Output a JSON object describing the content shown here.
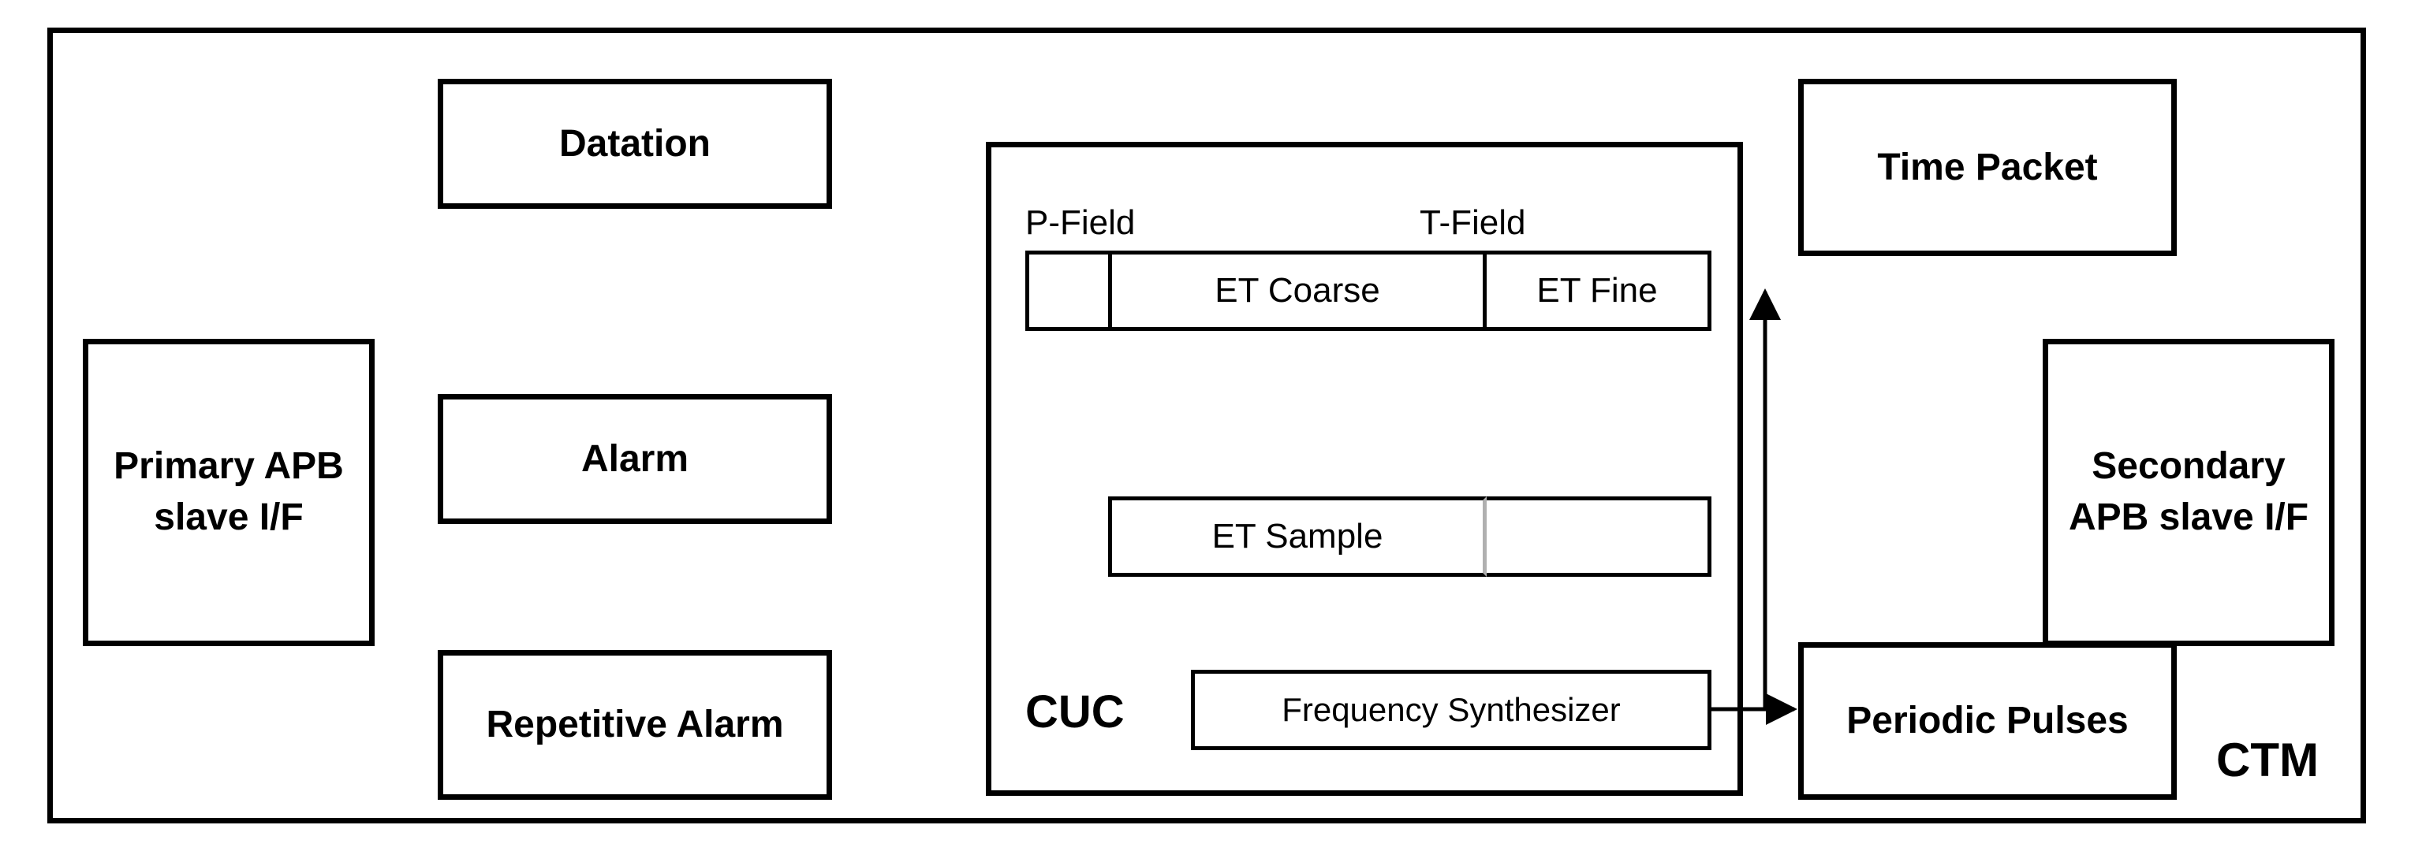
{
  "outer_label": "CTM",
  "left_slave": "Primary\nAPB\nslave\nI/F",
  "right_slave": "Secondary\nAPB\nslave\nI/F",
  "left_blocks": {
    "datation": "Datation",
    "alarm": "Alarm",
    "repetitive_alarm": "Repetitive\nAlarm"
  },
  "right_blocks": {
    "time_packet": "Time\nPacket",
    "periodic_pulses": "Periodic\nPulses"
  },
  "cuc": {
    "label": "CUC",
    "pfield": "P-Field",
    "tfield": "T-Field",
    "et_coarse": "ET Coarse",
    "et_fine": "ET Fine",
    "et_sample": "ET Sample",
    "freq_synth": "Frequency Synthesizer"
  }
}
